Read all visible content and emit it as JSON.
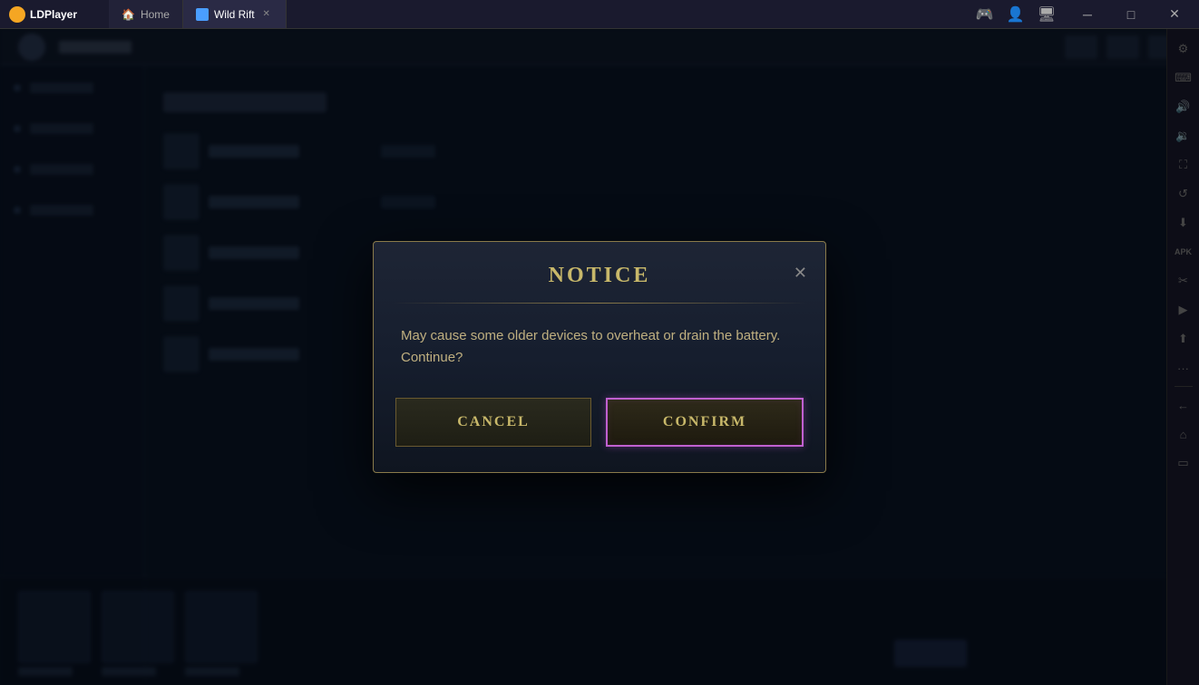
{
  "titlebar": {
    "app_name": "LDPlayer",
    "tabs": [
      {
        "id": "home",
        "label": "Home",
        "icon": "home",
        "active": false
      },
      {
        "id": "wildrift",
        "label": "Wild Rift",
        "icon": "game",
        "active": true
      }
    ],
    "window_controls": {
      "back": "❮",
      "minimize": "─",
      "maximize": "□",
      "close": "✕"
    }
  },
  "right_toolbar": {
    "buttons": [
      {
        "id": "settings",
        "icon": "⚙"
      },
      {
        "id": "keyboard",
        "icon": "⌨"
      },
      {
        "id": "volume-up",
        "icon": "🔊"
      },
      {
        "id": "volume-down",
        "icon": "🔉"
      },
      {
        "id": "fullscreen",
        "icon": "⛶"
      },
      {
        "id": "refresh",
        "icon": "↺"
      },
      {
        "id": "import",
        "icon": "⬇"
      },
      {
        "id": "apk",
        "icon": "APK"
      },
      {
        "id": "scissors",
        "icon": "✂"
      },
      {
        "id": "record",
        "icon": "▶"
      },
      {
        "id": "share",
        "icon": "⬆"
      },
      {
        "id": "more",
        "icon": "···"
      },
      {
        "id": "back",
        "icon": "←"
      },
      {
        "id": "home-btn",
        "icon": "⌂"
      },
      {
        "id": "recents",
        "icon": "▭"
      }
    ]
  },
  "dialog": {
    "title": "NOTICE",
    "close_icon": "✕",
    "message": "May cause some older devices to overheat or drain the battery. Continue?",
    "cancel_label": "CANCEL",
    "confirm_label": "CONFIRM"
  }
}
